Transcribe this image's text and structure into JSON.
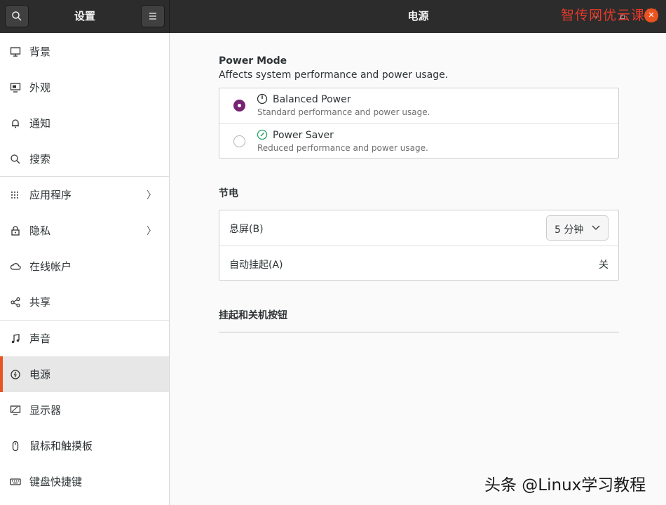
{
  "header": {
    "sidebar_title": "设置",
    "page_title": "电源",
    "watermark": "智传网优云课堂",
    "close_glyph": "✕",
    "minimize_glyph": "–",
    "restore_glyph": "▫"
  },
  "sidebar": {
    "items": [
      {
        "label": "背景",
        "icon": "monitor-icon"
      },
      {
        "label": "外观",
        "icon": "appearance-icon"
      },
      {
        "label": "通知",
        "icon": "bell-icon"
      },
      {
        "label": "搜索",
        "icon": "search-icon"
      },
      {
        "label": "应用程序",
        "icon": "apps-grid-icon",
        "chevron": "〉"
      },
      {
        "label": "隐私",
        "icon": "lock-icon",
        "chevron": "〉"
      },
      {
        "label": "在线帐户",
        "icon": "cloud-icon"
      },
      {
        "label": "共享",
        "icon": "share-icon"
      },
      {
        "label": "声音",
        "icon": "music-note-icon"
      },
      {
        "label": "电源",
        "icon": "power-icon",
        "active": true
      },
      {
        "label": "显示器",
        "icon": "display-icon"
      },
      {
        "label": "鼠标和触摸板",
        "icon": "mouse-icon"
      },
      {
        "label": "键盘快捷键",
        "icon": "keyboard-icon"
      }
    ]
  },
  "power_mode": {
    "title": "Power Mode",
    "subtitle": "Affects system performance and power usage.",
    "options": [
      {
        "name": "Balanced Power",
        "description": "Standard performance and power usage.",
        "selected": true,
        "icon": "gauge-icon"
      },
      {
        "name": "Power Saver",
        "description": "Reduced performance and power usage.",
        "selected": false,
        "icon": "leaf-gauge-icon"
      }
    ]
  },
  "power_saving": {
    "title": "节电",
    "blank_screen_label": "息屏(B)",
    "blank_screen_value": "5 分钟",
    "auto_suspend_label": "自动挂起(A)",
    "auto_suspend_value": "关"
  },
  "buttons_section": {
    "title": "挂起和关机按钮"
  },
  "footer": {
    "watermark": "头条 @Linux学习教程"
  },
  "colors": {
    "accent": "#e95420",
    "radio_checked": "#762572",
    "header_bg": "#2c2c2c",
    "watermark_red": "#e53a2a"
  }
}
